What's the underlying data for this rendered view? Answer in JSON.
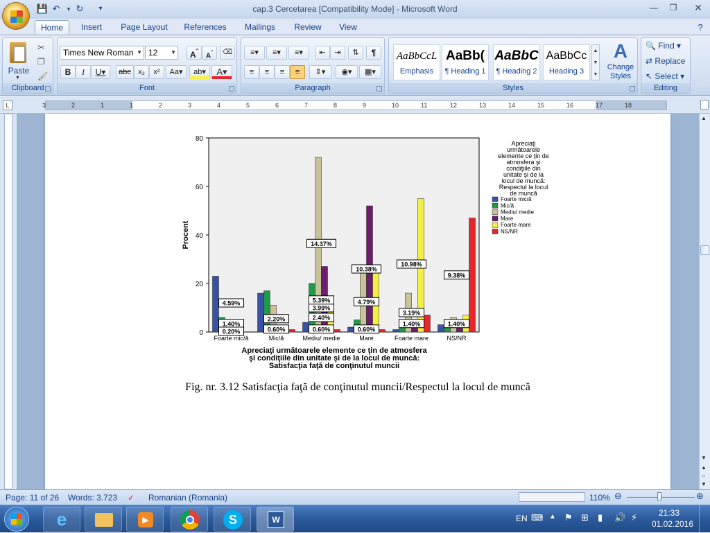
{
  "window": {
    "title": "cap.3 Cercetarea [Compatibility Mode] - Microsoft Word"
  },
  "tabs": [
    "Home",
    "Insert",
    "Page Layout",
    "References",
    "Mailings",
    "Review",
    "View"
  ],
  "ribbon": {
    "clipboard": {
      "label": "Clipboard",
      "paste": "Paste"
    },
    "font": {
      "label": "Font",
      "name": "Times New Roman",
      "size": "12"
    },
    "paragraph": {
      "label": "Paragraph"
    },
    "styles": {
      "label": "Styles",
      "items": [
        {
          "preview": "AaBbCcL",
          "name": "Emphasis"
        },
        {
          "preview": "AaBb(",
          "name": "¶ Heading 1"
        },
        {
          "preview": "AaBbC",
          "name": "¶ Heading 2"
        },
        {
          "preview": "AaBbCc",
          "name": "Heading 3"
        }
      ],
      "change_styles": "Change Styles"
    },
    "editing": {
      "label": "Editing",
      "find": "Find",
      "replace": "Replace",
      "select": "Select"
    }
  },
  "ruler": {
    "numbers": [
      "3",
      "2",
      "1",
      "1",
      "2",
      "3",
      "4",
      "5",
      "6",
      "7",
      "8",
      "9",
      "10",
      "11",
      "12",
      "13",
      "14",
      "15",
      "16",
      "17",
      "18"
    ]
  },
  "document": {
    "caption": "Fig. nr. 3.12 Satisfacţia faţă de conţinutul muncii/Respectul la locul de muncă"
  },
  "chart_data": {
    "type": "bar",
    "ylabel": "Procent",
    "xlabel_lines": [
      "Apreciaţi următoarele elemente ce ţin de atmosfera",
      "şi condiţiile din unitate şi de la locul de muncă:",
      "Satisfacţia faţă de conţinutul muncii"
    ],
    "ylim": [
      0,
      80
    ],
    "yticks": [
      "0",
      "20",
      "40",
      "60",
      "80"
    ],
    "categories": [
      "Foarte mic/ă",
      "Mic/ă",
      "Mediu/ medie",
      "Mare",
      "Foarte mare",
      "NS/NR"
    ],
    "legend_title_lines": [
      "Apreciaţi",
      "următoarele",
      "elemente ce ţin de",
      "atmosfera şi",
      "condiţiile din",
      "unitate şi de la",
      "locul de muncă:",
      "Respectul la locul",
      "de muncă"
    ],
    "legend_position": "right",
    "series": [
      {
        "name": "Foarte mic/ă",
        "color": "#3953a4",
        "values": [
          23,
          16,
          4,
          2,
          1,
          3
        ]
      },
      {
        "name": "Mic/ă",
        "color": "#1f9a48",
        "values": [
          6,
          17,
          20,
          5,
          3,
          2
        ]
      },
      {
        "name": "Mediu/ medie",
        "color": "#c9c39a",
        "values": [
          2,
          11,
          72,
          25,
          16,
          6
        ]
      },
      {
        "name": "Mare",
        "color": "#6b1f6d",
        "values": [
          0,
          2,
          27,
          52,
          2,
          2
        ]
      },
      {
        "name": "Foarte mare",
        "color": "#f4ef43",
        "values": [
          1,
          1,
          9,
          26,
          55,
          7
        ]
      },
      {
        "name": "NS/NR",
        "color": "#e4262d",
        "values": [
          0,
          1,
          1,
          1,
          7,
          47
        ]
      }
    ],
    "annotations": [
      {
        "text": "4.59%",
        "cat": 0,
        "y": 12
      },
      {
        "text": "1.40%",
        "cat": 0,
        "y": 3.5
      },
      {
        "text": "0.20%",
        "cat": 0,
        "y": 0.3
      },
      {
        "text": "2.20%",
        "cat": 1,
        "y": 5.5
      },
      {
        "text": "0.60%",
        "cat": 1,
        "y": 1.2
      },
      {
        "text": "3.99%",
        "cat": 2,
        "y": 10
      },
      {
        "text": "5.39%",
        "cat": 2,
        "y": 13.2
      },
      {
        "text": "2.40%",
        "cat": 2,
        "y": 6
      },
      {
        "text": "0.60%",
        "cat": 2,
        "y": 1.2
      },
      {
        "text": "14.37%",
        "cat": 2,
        "y": 36.5
      },
      {
        "text": "10.38%",
        "cat": 3,
        "y": 26
      },
      {
        "text": "4.79%",
        "cat": 3,
        "y": 12.5
      },
      {
        "text": "0.60%",
        "cat": 3,
        "y": 1.2
      },
      {
        "text": "10.98%",
        "cat": 4,
        "y": 28
      },
      {
        "text": "3.19%",
        "cat": 4,
        "y": 8
      },
      {
        "text": "1.40%",
        "cat": 4,
        "y": 3.5
      },
      {
        "text": "1.40%",
        "cat": 5,
        "y": 3.5
      },
      {
        "text": "9.38%",
        "cat": 5,
        "y": 23.5
      }
    ]
  },
  "statusbar": {
    "page": "Page: 11 of 26",
    "words": "Words: 3.723",
    "language": "Romanian (Romania)",
    "zoom": "110%"
  },
  "tray": {
    "lang": "EN",
    "time": "21:33",
    "date": "01.02.2016"
  }
}
